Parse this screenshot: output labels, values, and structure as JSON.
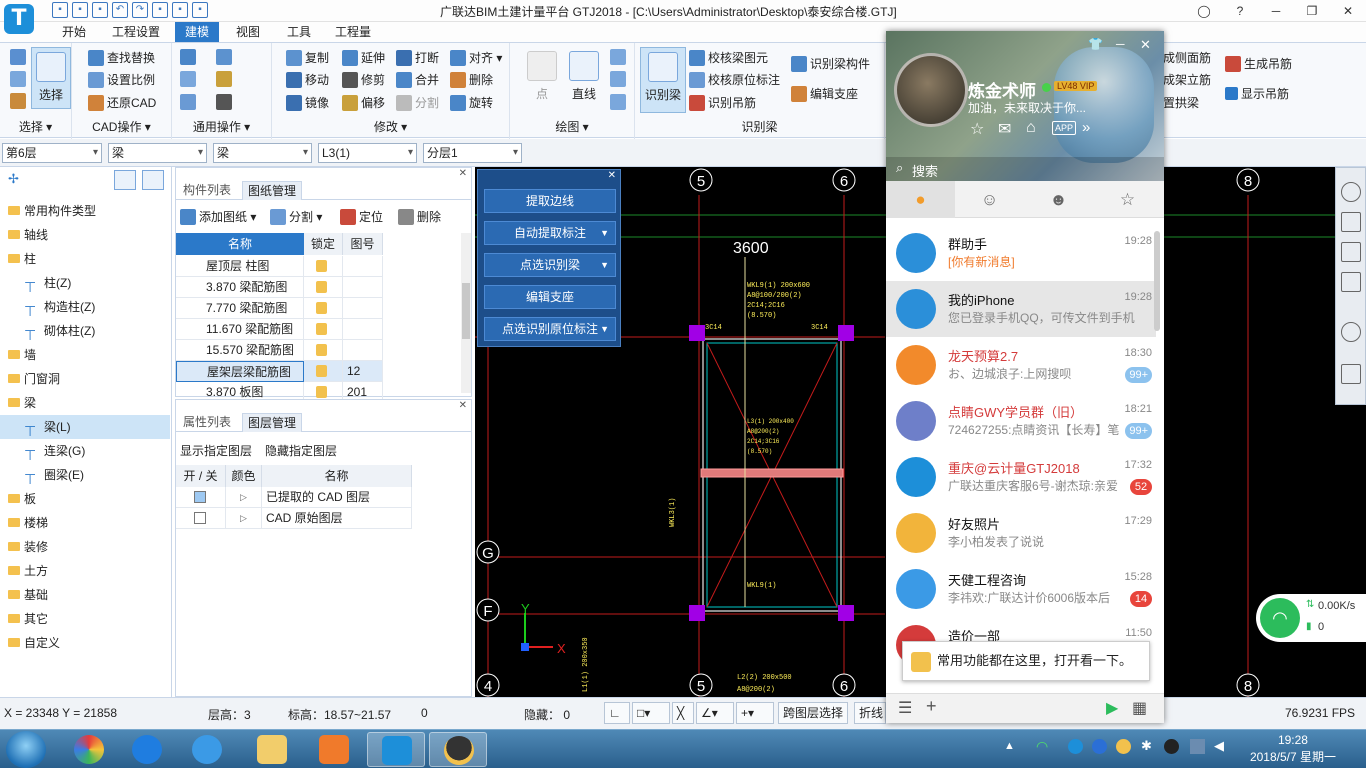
{
  "window": {
    "title": "广联达BIM土建计量平台 GTJ2018 - [C:\\Users\\Administrator\\Desktop\\泰安综合楼.GTJ]",
    "logo": "T"
  },
  "menu": [
    "开始",
    "工程设置",
    "建模",
    "视图",
    "工具",
    "工程量"
  ],
  "ribbon": {
    "select": {
      "big": "选择",
      "label": "选择 ▾"
    },
    "cad": {
      "items": [
        "查找替换",
        "设置比例",
        "还原CAD"
      ],
      "label": "CAD操作 ▾"
    },
    "common": {
      "label": "通用操作 ▾"
    },
    "modify": {
      "items": [
        "复制",
        "延伸",
        "打断",
        "对齐 ▾",
        "移动",
        "修剪",
        "合并",
        "删除",
        "镜像",
        "偏移",
        "分割",
        "旋转"
      ],
      "label": "修改 ▾"
    },
    "draw": {
      "point": "点",
      "line": "直线",
      "label": "绘图 ▾"
    },
    "identify": {
      "big": "识别梁",
      "items": [
        "校核梁图元",
        "校核原位标注",
        "识别吊筋",
        "识别梁构件",
        "编辑支座"
      ],
      "label": "识别梁"
    },
    "extra": {
      "items": [
        "成侧面筋",
        "成架立筋",
        "置拱梁",
        "生成吊筋",
        "显示吊筋"
      ]
    }
  },
  "combos": [
    "第6层",
    "梁",
    "梁",
    "L3(1)",
    "分层1"
  ],
  "tree": [
    {
      "label": "常用构件类型",
      "lvl": 0
    },
    {
      "label": "轴线",
      "lvl": 0
    },
    {
      "label": "柱",
      "lvl": 0
    },
    {
      "label": "柱(Z)",
      "lvl": 1
    },
    {
      "label": "构造柱(Z)",
      "lvl": 1
    },
    {
      "label": "砌体柱(Z)",
      "lvl": 1
    },
    {
      "label": "墙",
      "lvl": 0
    },
    {
      "label": "门窗洞",
      "lvl": 0
    },
    {
      "label": "梁",
      "lvl": 0
    },
    {
      "label": "梁(L)",
      "lvl": 1
    },
    {
      "label": "连梁(G)",
      "lvl": 1
    },
    {
      "label": "圈梁(E)",
      "lvl": 1
    },
    {
      "label": "板",
      "lvl": 0
    },
    {
      "label": "楼梯",
      "lvl": 0
    },
    {
      "label": "装修",
      "lvl": 0
    },
    {
      "label": "土方",
      "lvl": 0
    },
    {
      "label": "基础",
      "lvl": 0
    },
    {
      "label": "其它",
      "lvl": 0
    },
    {
      "label": "自定义",
      "lvl": 0
    }
  ],
  "panel1": {
    "tabs": [
      "构件列表",
      "图纸管理"
    ],
    "tools": [
      "添加图纸 ▾",
      "分割 ▾",
      "定位",
      "删除"
    ],
    "headers": [
      "名称",
      "锁定",
      "图号"
    ],
    "rows": [
      {
        "name": "屋顶层 柱图",
        "no": ""
      },
      {
        "name": "3.870  梁配筋图",
        "no": ""
      },
      {
        "name": "7.770  梁配筋图",
        "no": ""
      },
      {
        "name": "11.670  梁配筋图",
        "no": ""
      },
      {
        "name": "15.570  梁配筋图",
        "no": ""
      },
      {
        "name": "屋架层梁配筋图",
        "no": "12"
      },
      {
        "name": "3.870 板图",
        "no": "201"
      }
    ]
  },
  "panel2": {
    "tabs": [
      "属性列表",
      "图层管理"
    ],
    "tools": [
      "显示指定图层",
      "隐藏指定图层"
    ],
    "headers": [
      "开 / 关",
      "颜色",
      "名称"
    ],
    "rows": [
      "已提取的 CAD 图层",
      "CAD 原始图层"
    ]
  },
  "floatpanel": [
    "提取边线",
    "自动提取标注",
    "点选识别梁",
    "编辑支座",
    "点选识别原位标注"
  ],
  "cad": {
    "axis_top": [
      "5",
      "6",
      "8"
    ],
    "axis_bottom": [
      "4",
      "5",
      "6",
      "8"
    ],
    "axis_left": [
      "G",
      "F"
    ],
    "dim": "3600",
    "y": "Y",
    "x": "X"
  },
  "status": {
    "coord": "X = 23348 Y = 21858",
    "floor_h": "层高：3",
    "elev": "标高：18.57~21.57",
    "zero": "0",
    "hidden": "隐藏： 0",
    "cross": "跨图层选择",
    "fold": "折线",
    "fps": "76.9231 FPS"
  },
  "qq": {
    "name": "炼金术师",
    "level": "LV48 VIP",
    "sign": "加油，未来取决于你...",
    "search": "搜索",
    "contacts": [
      {
        "name": "群助手",
        "msg": "[你有新消息]",
        "time": "19:28",
        "badge": ""
      },
      {
        "name": "我的iPhone",
        "msg": "您已登录手机QQ，可传文件到手机",
        "time": "19:28",
        "badge": ""
      },
      {
        "name": "龙天预算2.7",
        "msg": "お、边城浪子:上网搜呗",
        "time": "18:30",
        "badge": "99+"
      },
      {
        "name": "点睛GWY学员群（旧）",
        "msg": "724627255:点睛资讯【长寿】笔",
        "time": "18:21",
        "badge": "99+"
      },
      {
        "name": "重庆@云计量GTJ2018",
        "msg": "广联达重庆客服6号-谢杰琼:亲爱",
        "time": "17:32",
        "badge": "52"
      },
      {
        "name": "好友照片",
        "msg": "李小柏发表了说说",
        "time": "17:29",
        "badge": ""
      },
      {
        "name": "天健工程咨询",
        "msg": "李祎欢:广联达计价6006版本后",
        "time": "15:28",
        "badge": "14"
      },
      {
        "name": "造价一部",
        "msg": "",
        "time": "11:50",
        "badge": ""
      }
    ],
    "tip": "常用功能都在这里，打开看一下。"
  },
  "net": {
    "speed": "0.00K/s",
    "count": "0"
  },
  "clock": {
    "time": "19:28",
    "date": "2018/5/7 星期一"
  }
}
